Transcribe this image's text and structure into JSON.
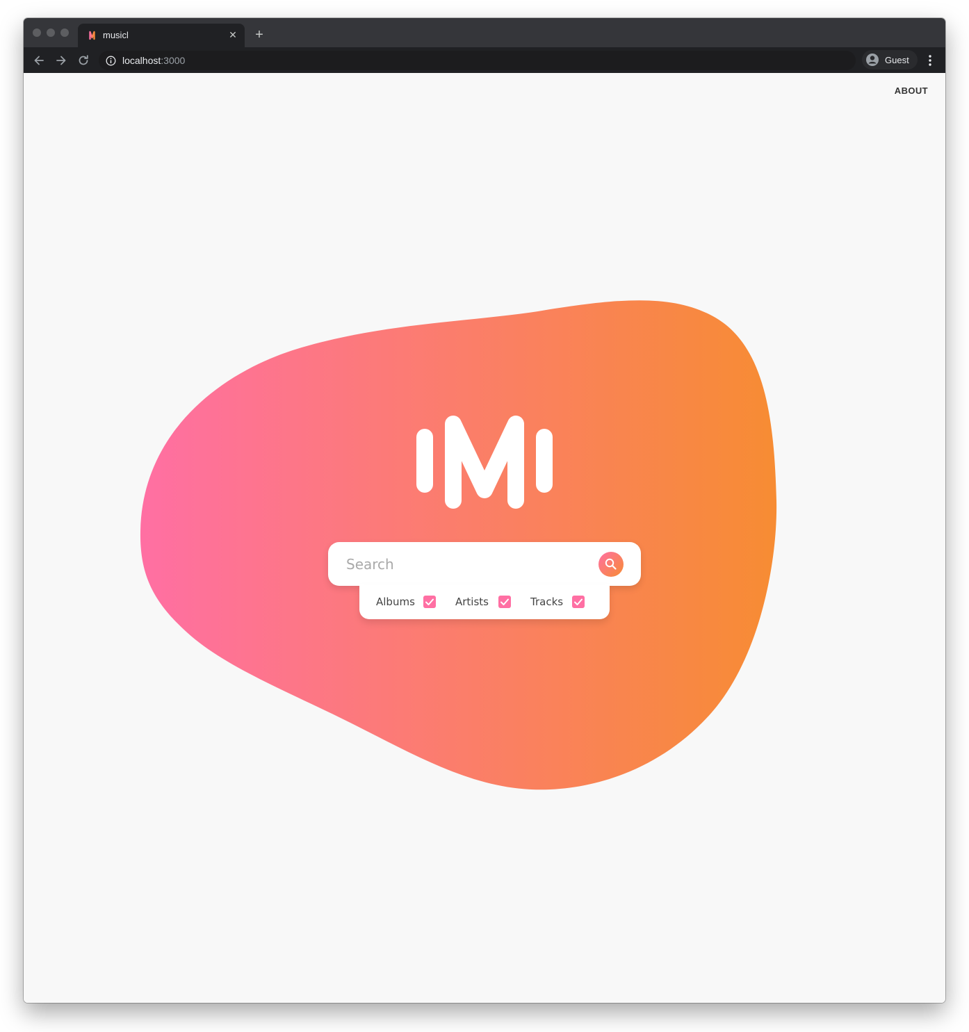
{
  "browser": {
    "tab_title": "musicl",
    "url_host": "localhost",
    "url_port": ":3000",
    "profile_label": "Guest",
    "new_tab_symbol": "+",
    "close_symbol": "✕"
  },
  "header": {
    "about_label": "ABOUT"
  },
  "search": {
    "placeholder": "Search",
    "value": ""
  },
  "filters": [
    {
      "label": "Albums",
      "checked": true
    },
    {
      "label": "Artists",
      "checked": true
    },
    {
      "label": "Tracks",
      "checked": true
    }
  ],
  "colors": {
    "gradient_start": "#ff6fa3",
    "gradient_end": "#f78c33",
    "background": "#f8f8f8"
  }
}
